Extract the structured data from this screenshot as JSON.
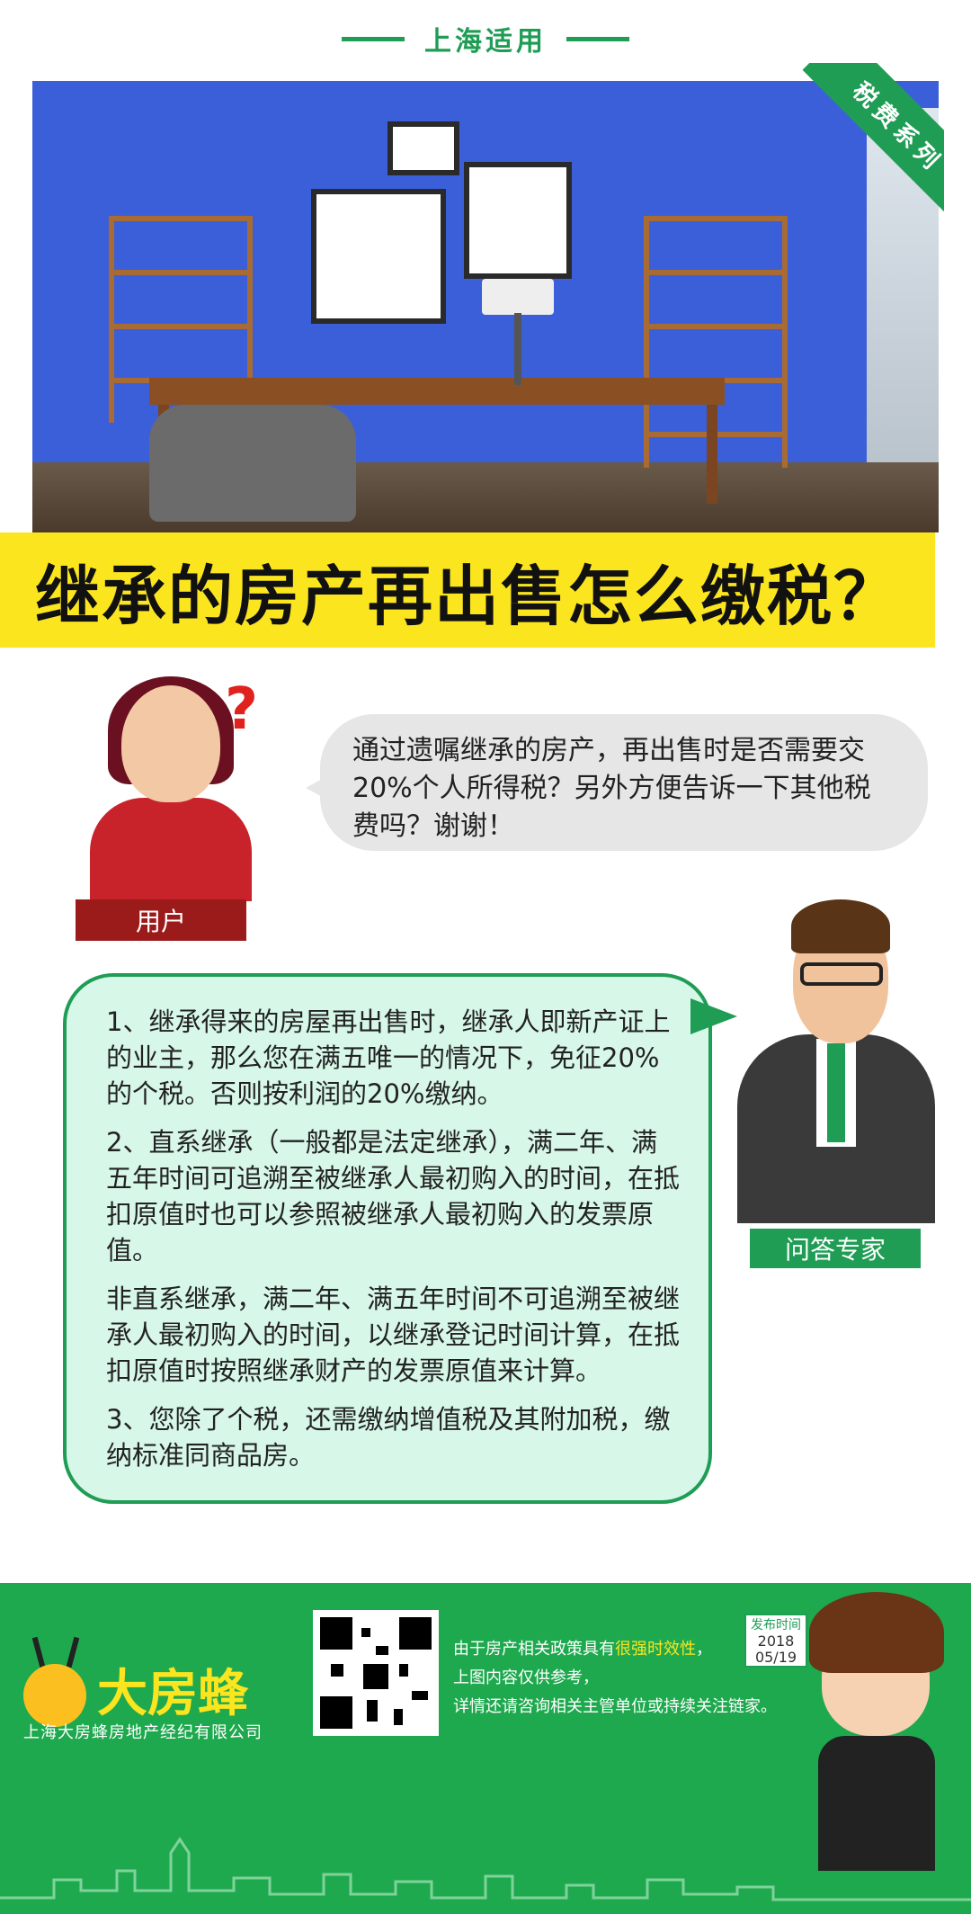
{
  "header": {
    "tag": "上海适用"
  },
  "badge": {
    "label": "税费系列"
  },
  "title": "继承的房产再出售怎么缴税？",
  "user": {
    "label": "用户",
    "question": "通过遗嘱继承的房产，再出售时是否需要交20%个人所得税？另外方便告诉一下其他税费吗？谢谢！"
  },
  "expert": {
    "label": "问答专家",
    "answers": [
      "1、继承得来的房屋再出售时，继承人即新产证上的业主，那么您在满五唯一的情况下，免征20%的个税。否则按利润的20%缴纳。",
      "2、直系继承（一般都是法定继承），满二年、满五年时间可追溯至被继承人最初购入的时间，在抵扣原值时也可以参照被继承人最初购入的发票原值。",
      "非直系继承，满二年、满五年时间不可追溯至被继承人最初购入的时间，以继承登记时间计算，在抵扣原值时按照继承财产的发票原值来计算。",
      "3、您除了个税，还需缴纳增值税及其附加税，缴纳标准同商品房。"
    ]
  },
  "footer": {
    "brand": "大房蜂",
    "company": "上海大房蜂房地产经纪有限公司",
    "notice_line1_pre": "由于房产相关政策具有",
    "notice_line1_hl": "很强时效性",
    "notice_line1_post": "，",
    "notice_line2": "上图内容仅供参考，",
    "notice_line3": "详情还请咨询相关主管单位或持续关注链家。",
    "date_label": "发布时间",
    "date_year": "2018",
    "date_md": "05/19"
  },
  "colors": {
    "green": "#1f9d55",
    "yellow": "#fbe51f",
    "red": "#9b1b1b"
  }
}
